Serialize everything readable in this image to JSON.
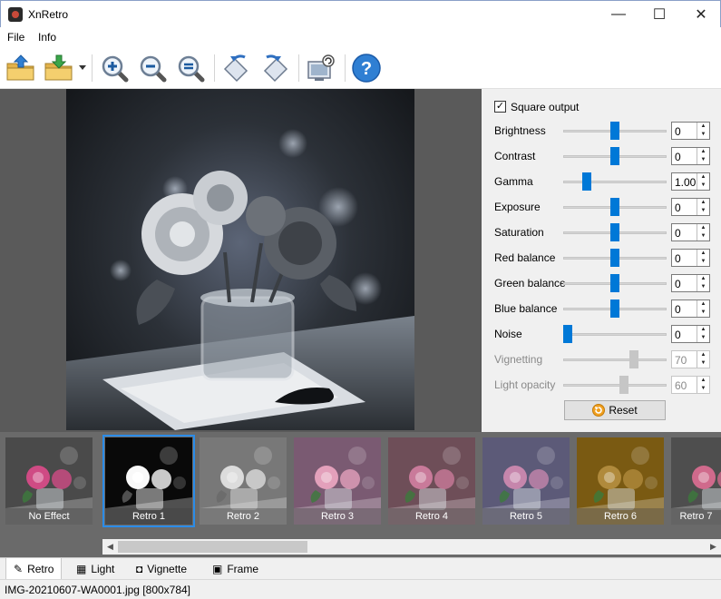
{
  "window": {
    "title": "XnRetro",
    "minimize": "—",
    "maximize": "☐",
    "close": "✕"
  },
  "menu": [
    {
      "label": "File"
    },
    {
      "label": "Info"
    }
  ],
  "toolbar": {
    "items": [
      "open-folder",
      "save-image",
      "zoom-in",
      "zoom-out",
      "zoom-fit",
      "rotate-left",
      "rotate-right",
      "screen-export",
      "help"
    ],
    "help_glyph": "?"
  },
  "adjust": {
    "square_output": {
      "label": "Square output",
      "checked": true,
      "mark": "✓"
    },
    "sliders": [
      {
        "name": "brightness",
        "label": "Brightness",
        "value": "0",
        "level": 0.5,
        "enabled": true
      },
      {
        "name": "contrast",
        "label": "Contrast",
        "value": "0",
        "level": 0.5,
        "enabled": true
      },
      {
        "name": "gamma",
        "label": "Gamma",
        "value": "1.00",
        "level": 0.2,
        "enabled": true
      },
      {
        "name": "exposure",
        "label": "Exposure",
        "value": "0",
        "level": 0.5,
        "enabled": true
      },
      {
        "name": "saturation",
        "label": "Saturation",
        "value": "0",
        "level": 0.5,
        "enabled": true
      },
      {
        "name": "red-balance",
        "label": "Red balance",
        "value": "0",
        "level": 0.5,
        "enabled": true
      },
      {
        "name": "green-balance",
        "label": "Green balance",
        "value": "0",
        "level": 0.5,
        "enabled": true
      },
      {
        "name": "blue-balance",
        "label": "Blue balance",
        "value": "0",
        "level": 0.5,
        "enabled": true
      },
      {
        "name": "noise",
        "label": "Noise",
        "value": "0",
        "level": 0.0,
        "enabled": true
      },
      {
        "name": "vignetting",
        "label": "Vignetting",
        "value": "70",
        "level": 0.7,
        "enabled": false
      },
      {
        "name": "light-opacity",
        "label": "Light opacity",
        "value": "60",
        "level": 0.6,
        "enabled": false
      }
    ],
    "reset_label": "Reset"
  },
  "presets": [
    {
      "label": "No Effect",
      "tint": "#cf4b84",
      "bg": "#4a4a4a",
      "filter": "none",
      "selected": false
    },
    {
      "label": "Retro 1",
      "tint": "#dddddd",
      "bg": "#20252c",
      "filter": "grayscale(1) contrast(1.3)",
      "selected": true
    },
    {
      "label": "Retro 2",
      "tint": "#dcdcdc",
      "bg": "#787878",
      "filter": "grayscale(1)",
      "selected": false
    },
    {
      "label": "Retro 3",
      "tint": "#e3a0bb",
      "bg": "#7a5a72",
      "filter": "none",
      "selected": false
    },
    {
      "label": "Retro 4",
      "tint": "#c97a9a",
      "bg": "#6e4e58",
      "filter": "none",
      "selected": false
    },
    {
      "label": "Retro 5",
      "tint": "#c686ac",
      "bg": "#5c5a78",
      "filter": "none",
      "selected": false
    },
    {
      "label": "Retro 6",
      "tint": "#b08a3c",
      "bg": "#7a5a12",
      "filter": "none",
      "selected": false
    },
    {
      "label": "Retro 7",
      "tint": "#d06a8c",
      "bg": "#4e4e4e",
      "filter": "none",
      "selected": false
    }
  ],
  "tabs": [
    {
      "name": "retro",
      "label": "Retro",
      "icon": "magic-wand-icon",
      "glyph": "✎",
      "active": true
    },
    {
      "name": "light",
      "label": "Light",
      "icon": "grid-icon",
      "glyph": "▦",
      "active": false
    },
    {
      "name": "vignette",
      "label": "Vignette",
      "icon": "vignette-icon",
      "glyph": "◘",
      "active": false
    },
    {
      "name": "frame",
      "label": "Frame",
      "icon": "frame-icon",
      "glyph": "▣",
      "active": false
    }
  ],
  "status": {
    "text": "IMG-20210607-WA0001.jpg [800x784]"
  },
  "scroll": {
    "left": "◀",
    "right": "▶"
  },
  "colors": {
    "accent": "#0078d7",
    "selected_outline": "#2b8ce8"
  }
}
